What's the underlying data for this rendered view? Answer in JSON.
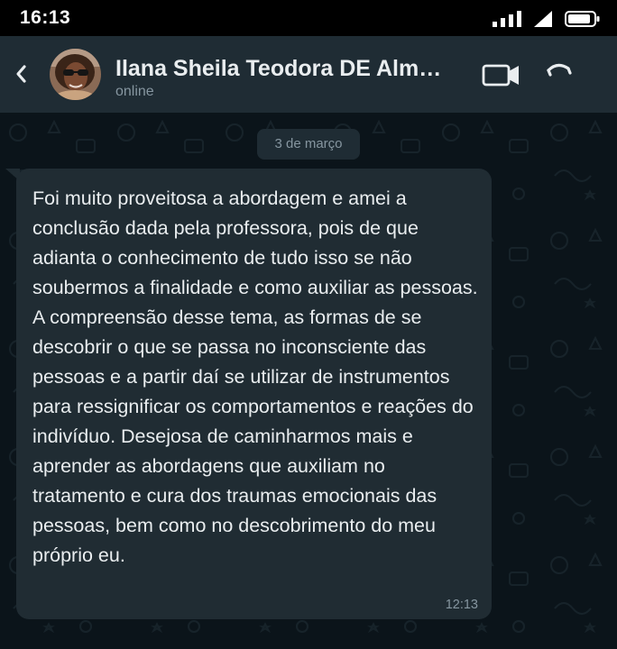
{
  "status_bar": {
    "time": "16:13",
    "icons": [
      "signal-bars-icon",
      "cell-signal-icon",
      "battery-icon"
    ]
  },
  "header": {
    "back_icon": "chevron-left-icon",
    "contact_name": "Ilana Sheila Teodora DE Alm…",
    "contact_status": "online",
    "video_icon": "video-camera-icon",
    "call_icon": "phone-icon"
  },
  "chat": {
    "date_label": "3 de março",
    "messages": [
      {
        "direction": "incoming",
        "text": "Foi muito proveitosa a abordagem e amei a conclusão dada pela professora, pois de que adianta o conhecimento de tudo isso se não soubermos a finalidade e como auxiliar as pessoas. A compreensão desse tema, as formas de se descobrir o que se passa no inconsciente das pessoas e a partir daí se utilizar de instrumentos para ressignificar os comportamentos e reações do indivíduo. Desejosa de caminharmos mais e aprender as abordagens que auxiliam no tratamento e cura dos traumas emocionais das pessoas, bem como no descobrimento do meu próprio eu.",
        "time": "12:13"
      }
    ]
  },
  "colors": {
    "header_bg": "#1f2c34",
    "chat_bg": "#0b141a",
    "bubble_bg": "#202c33",
    "text_primary": "#e9edef",
    "text_secondary": "#8696a0"
  }
}
